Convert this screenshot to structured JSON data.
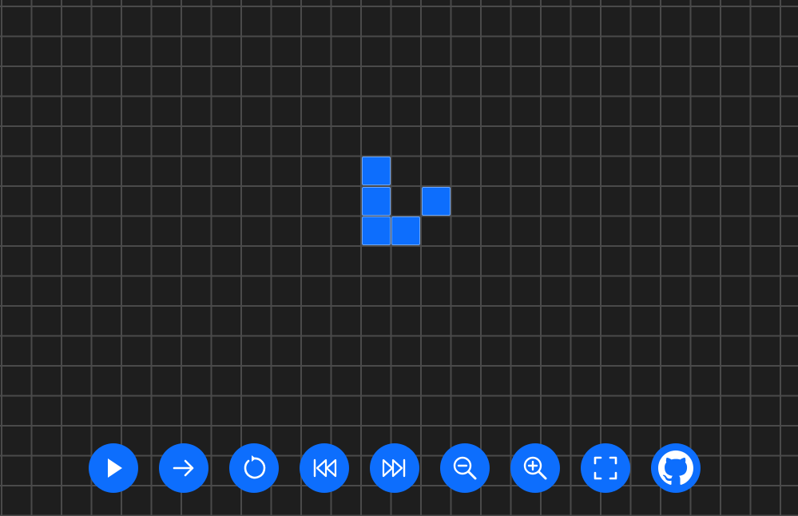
{
  "board": {
    "background_color": "#1e1e1e",
    "grid_color": "#4a4a4a",
    "live_cell_color": "#0d6efd",
    "live_cells": [
      {
        "col": 12,
        "row": 5
      },
      {
        "col": 12,
        "row": 6
      },
      {
        "col": 14,
        "row": 6
      },
      {
        "col": 12,
        "row": 7
      },
      {
        "col": 13,
        "row": 7
      }
    ]
  },
  "toolbar": {
    "buttons": [
      {
        "name": "play-button",
        "icon": "play-icon"
      },
      {
        "name": "step-button",
        "icon": "arrow-right-icon"
      },
      {
        "name": "reset-button",
        "icon": "rotate-icon"
      },
      {
        "name": "slower-button",
        "icon": "rewind-icon"
      },
      {
        "name": "faster-button",
        "icon": "fast-forward-icon"
      },
      {
        "name": "zoom-out-button",
        "icon": "zoom-out-icon"
      },
      {
        "name": "zoom-in-button",
        "icon": "zoom-in-icon"
      },
      {
        "name": "fullscreen-button",
        "icon": "fullscreen-icon"
      },
      {
        "name": "github-button",
        "icon": "github-icon"
      }
    ]
  }
}
